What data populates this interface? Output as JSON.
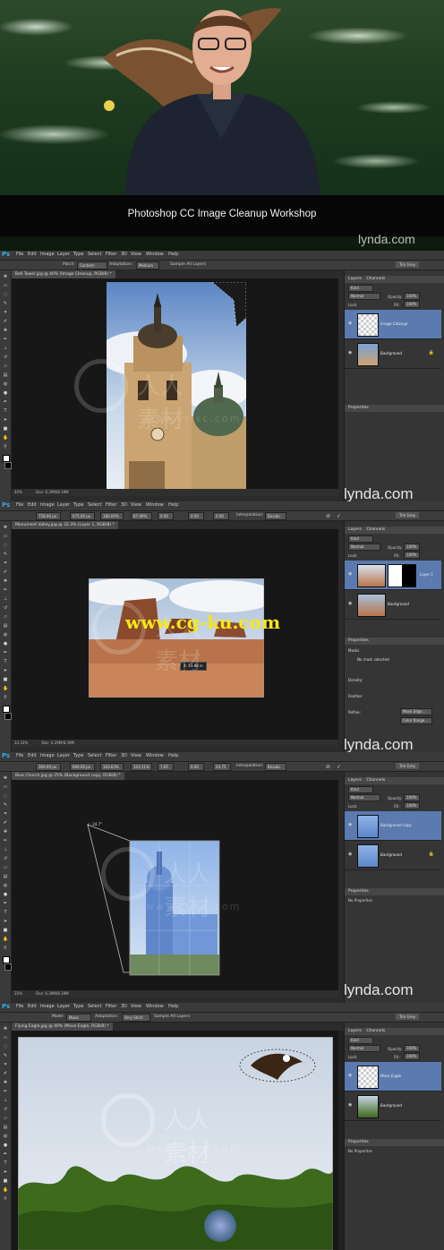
{
  "hero": {
    "title": "Photoshop CC Image Cleanup Workshop",
    "brand": "lynda.com"
  },
  "menu": [
    "File",
    "Edit",
    "Image",
    "Layer",
    "Type",
    "Select",
    "Filter",
    "3D",
    "View",
    "Window",
    "Help"
  ],
  "app_icon": "Ps",
  "workspace": "Tim Grey",
  "panels": [
    {
      "options": {
        "patch_label": "Patch:",
        "patch_value": "Content-Aware",
        "adaptation_label": "Adaptation:",
        "adaptation_value": "Medium",
        "sample_label": "Sample All Layers"
      },
      "doc_tab": "Bell Tower.jpg @ 40% (Image Cleanup, RGB/8) *",
      "zoom": "40%",
      "doc_size": "Doc: 6.29M/8.39M",
      "layers_tab": "Layers",
      "channels_tab": "Channels",
      "kind": "Kind",
      "blend": "Normal",
      "opacity_label": "Opacity:",
      "opacity": "100%",
      "lock_label": "Lock:",
      "fill_label": "Fill:",
      "fill": "100%",
      "layers": [
        {
          "name": "Image Cleanup",
          "selected": true
        },
        {
          "name": "Background",
          "selected": false
        }
      ],
      "properties_title": "Properties",
      "brand": "lynda.com"
    },
    {
      "options": {
        "x": "758.00 px",
        "y": "675.00 px",
        "w": "180.00%",
        "h": "87.09%",
        "angle": "0.00",
        "hskew": "0.00",
        "vskew": "0.00",
        "interp_label": "Interpolation:",
        "interp": "Bicubic"
      },
      "doc_tab": "Monument Valley.jpg @ 33.3% (Layer 1, RGB/8) *",
      "zoom": "33.33%",
      "doc_size": "Doc: 6.29M/8.39M",
      "transform_tip": "X: 13.88 in",
      "layers": [
        {
          "name": "Layer 1",
          "selected": true
        },
        {
          "name": "Background",
          "selected": false
        }
      ],
      "properties_title": "Properties",
      "masks_label": "Masks",
      "no_mask": "No mask selected",
      "density_label": "Density:",
      "feather_label": "Feather:",
      "refine_label": "Refine:",
      "mask_edge": "Mask Edge...",
      "color_range": "Color Range...",
      "brand": "lynda.com"
    },
    {
      "options": {
        "x": "369.00 px",
        "y": "696.00 px",
        "w": "163.63%",
        "h": "103.11%",
        "angle": "7.65",
        "hskew": "0.00",
        "vskew": "24.75",
        "interp_label": "Interpolation:",
        "interp": "Bicubic"
      },
      "doc_tab": "Blue Church.jpg @ 25% (Background copy, RGB/8) *",
      "zoom": "25%",
      "doc_size": "Doc: 6.29M/8.39M",
      "angle_tip": "∠: 24.7°",
      "layers": [
        {
          "name": "Background copy",
          "selected": true
        },
        {
          "name": "Background",
          "selected": false
        }
      ],
      "properties_title": "Properties",
      "no_props": "No Properties",
      "brand": "lynda.com"
    },
    {
      "options": {
        "mode_label": "Mode:",
        "mode": "Move",
        "adaptation_label": "Adaptation:",
        "adaptation": "Very Strict",
        "sample_label": "Sample All Layers"
      },
      "doc_tab": "Flying Eagle.jpg @ 40% (Move Eagle, RGB/8) *",
      "layers": [
        {
          "name": "Move Eagle",
          "selected": true
        },
        {
          "name": "Background",
          "selected": false
        }
      ],
      "properties_title": "Properties",
      "no_props": "No Properties"
    }
  ],
  "watermark": {
    "cn": "人人素材",
    "url": "www.rr-sc.com",
    "url2": "www.cg-ku.com"
  },
  "colors": {
    "ps_blue": "#39a7e8",
    "layer_selected": "#5a7ab0",
    "url_yellow": "#f6e71a"
  }
}
